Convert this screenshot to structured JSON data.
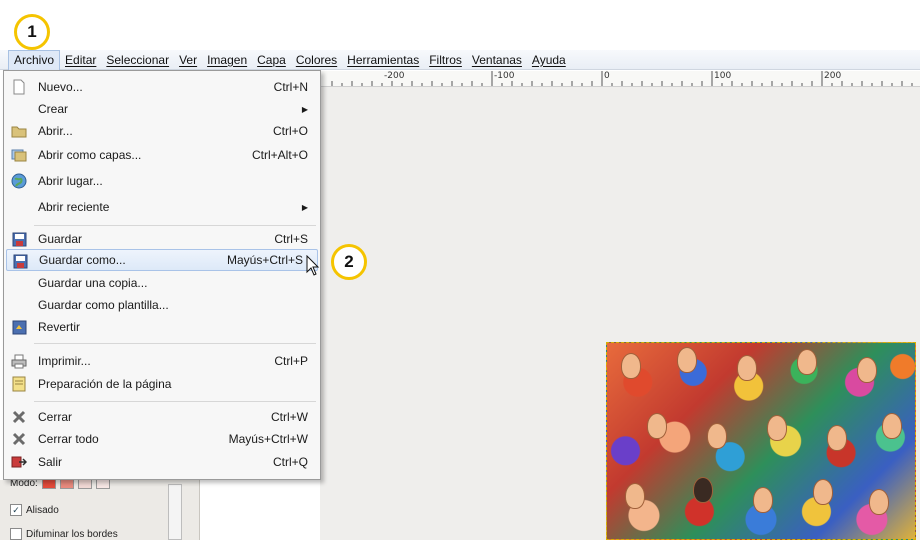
{
  "callouts": {
    "step1": "1",
    "step2": "2"
  },
  "menubar": {
    "items": [
      "Archivo",
      "Editar",
      "Seleccionar",
      "Ver",
      "Imagen",
      "Capa",
      "Colores",
      "Herramientas",
      "Filtros",
      "Ventanas",
      "Ayuda"
    ]
  },
  "ruler": {
    "labels": [
      "-200",
      "-100",
      "0",
      "100",
      "200"
    ]
  },
  "file_menu": {
    "items": [
      {
        "label": "Nuevo...",
        "shortcut": "Ctrl+N",
        "icon": "new-file-icon"
      },
      {
        "label": "Crear",
        "shortcut": "",
        "icon": ""
      },
      {
        "label": "Abrir...",
        "shortcut": "Ctrl+O",
        "icon": "folder-open-icon"
      },
      {
        "label": "Abrir como capas...",
        "shortcut": "Ctrl+Alt+O",
        "icon": "open-layers-icon"
      },
      {
        "label": "Abrir lugar...",
        "shortcut": "",
        "icon": "globe-icon"
      },
      {
        "label": "Abrir reciente",
        "shortcut": "",
        "icon": ""
      },
      {
        "label": "Guardar",
        "shortcut": "Ctrl+S",
        "icon": "save-icon"
      },
      {
        "label": "Guardar como...",
        "shortcut": "Mayús+Ctrl+S",
        "icon": "save-as-icon"
      },
      {
        "label": "Guardar una copia...",
        "shortcut": "",
        "icon": ""
      },
      {
        "label": "Guardar como plantilla...",
        "shortcut": "",
        "icon": ""
      },
      {
        "label": "Revertir",
        "shortcut": "",
        "icon": "revert-icon"
      },
      {
        "label": "Imprimir...",
        "shortcut": "Ctrl+P",
        "icon": "printer-icon"
      },
      {
        "label": "Preparación de la página",
        "shortcut": "",
        "icon": "page-setup-icon"
      },
      {
        "label": "Cerrar",
        "shortcut": "Ctrl+W",
        "icon": "close-icon"
      },
      {
        "label": "Cerrar todo",
        "shortcut": "Mayús+Ctrl+W",
        "icon": "close-all-icon"
      },
      {
        "label": "Salir",
        "shortcut": "Ctrl+Q",
        "icon": "quit-icon"
      }
    ]
  },
  "tool_options": {
    "mode_label": "Modo:",
    "antialias_label": "Alisado",
    "feather_label": "Difuminar los bordes"
  },
  "colors": {
    "callout": "#f5c400",
    "menu_hover": "#dde9f8",
    "accent": "#a9c3e8"
  }
}
